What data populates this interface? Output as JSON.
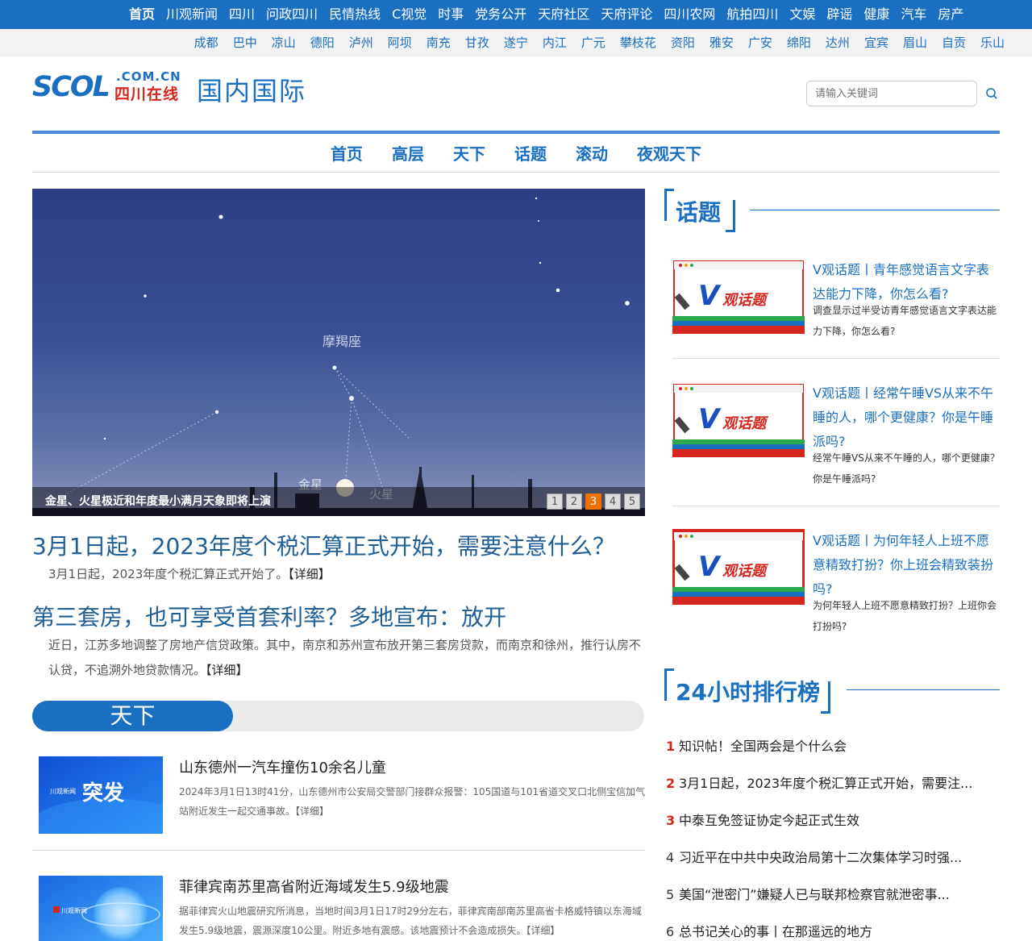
{
  "topnav": [
    "首页",
    "川观新闻",
    "四川",
    "问政四川",
    "民情热线",
    "C视觉",
    "时事",
    "党务公开",
    "天府社区",
    "天府评论",
    "四川农网",
    "航拍四川",
    "文娱",
    "辟谣",
    "健康",
    "汽车",
    "房产"
  ],
  "citynav": [
    "成都",
    "巴中",
    "凉山",
    "德阳",
    "泸州",
    "阿坝",
    "南充",
    "甘孜",
    "遂宁",
    "内江",
    "广元",
    "攀枝花",
    "资阳",
    "雅安",
    "广安",
    "绵阳",
    "达州",
    "宜宾",
    "眉山",
    "自贡",
    "乐山"
  ],
  "logo": {
    "scol": "SCOL",
    "domain": ".COM.CN",
    "name": "四川在线"
  },
  "section_title": "国内国际",
  "search": {
    "placeholder": "请输入关键词"
  },
  "subnav": [
    "首页",
    "高层",
    "天下",
    "话题",
    "滚动",
    "夜观天下"
  ],
  "slide": {
    "caption": "金星、火星极近和年度最小满月天象即将上演",
    "pages": [
      "1",
      "2",
      "3",
      "4",
      "5"
    ],
    "active_page": "3",
    "labels": {
      "constellation": "摩羯座",
      "venus": "金星",
      "mars": "火星"
    }
  },
  "headlines": [
    {
      "title": "3月1日起，2023年度个税汇算正式开始，需要注意什么？",
      "summary": "3月1日起，2023年度个税汇算正式开始了。",
      "more": "【详细】"
    },
    {
      "title": "第三套房，也可享受首套利率？多地宣布：放开",
      "summary": "近日，江苏多地调整了房地产信贷政策。其中，南京和苏州宣布放开第三套房贷款，而南京和徐州，推行认房不认贷，不追溯外地贷款情况。",
      "more": "【详细】"
    }
  ],
  "tianxia": {
    "label": "天下",
    "items": [
      {
        "title": "山东德州一汽车撞伤10余名儿童",
        "desc": "2024年3月1日13时41分，山东德州市公安局交警部门接群众报警：105国道与101省道交叉口北侧宝信加气站附近发生一起交通事故。",
        "more": "【详细】",
        "thumb_text": "突发",
        "thumb_brand": "川观新闻"
      },
      {
        "title": "菲律宾南苏里高省附近海域发生5.9级地震",
        "desc": "据菲律宾火山地震研究所消息，当地时间3月1日17时29分左右，菲律宾南部南苏里高省卡格威特镇以东海域发生5.9级地震，震源深度10公里。附近多地有震感。该地震预计不会造成损失。",
        "more": "【详细】",
        "thumb_brand": "川观新闻"
      }
    ]
  },
  "topics": {
    "label": "话题",
    "thumb_text": "观话题",
    "items": [
      {
        "title": "V观话题丨青年感觉语言文字表达能力下降，你怎么看?",
        "desc": "调查显示过半受访青年感觉语言文字表达能力下降，你怎么看?"
      },
      {
        "title": "V观话题丨经常午睡VS从来不午睡的人，哪个更健康？你是午睡派吗?",
        "desc": "经常午睡VS从来不午睡的人，哪个更健康？你是午睡派吗?"
      },
      {
        "title": "V观话题丨为何年轻人上班不愿意精致打扮？你上班会精致装扮吗?",
        "desc": "为何年轻人上班不愿意精致打扮？上班你会打扮吗?"
      }
    ]
  },
  "ranking": {
    "label": "24小时排行榜",
    "items": [
      {
        "num": "1",
        "text": "知识帖！全国两会是个什么会"
      },
      {
        "num": "2",
        "text": "3月1日起，2023年度个税汇算正式开始，需要注..."
      },
      {
        "num": "3",
        "text": "中泰互免签证协定今起正式生效"
      },
      {
        "num": "4",
        "text": "习近平在中共中央政治局第十二次集体学习时强..."
      },
      {
        "num": "5",
        "text": "美国“泄密门”嫌疑人已与联邦检察官就泄密事..."
      },
      {
        "num": "6",
        "text": "总书记关心的事丨在那遥远的地方"
      }
    ]
  },
  "colors": {
    "brand_blue": "#1a6fc0",
    "accent_red": "#d6261d",
    "pager_active": "#f07000"
  }
}
